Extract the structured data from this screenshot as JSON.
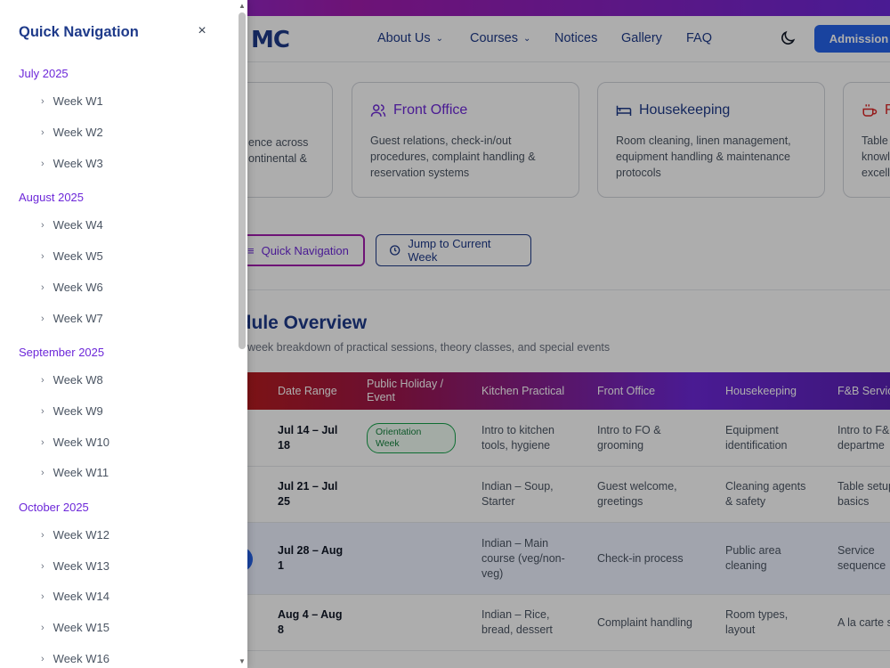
{
  "header": {
    "logo_main": "MC",
    "nav": [
      {
        "label": "About Us",
        "has_dropdown": true
      },
      {
        "label": "Courses",
        "has_dropdown": true
      },
      {
        "label": "Notices",
        "has_dropdown": false
      },
      {
        "label": "Gallery",
        "has_dropdown": false
      },
      {
        "label": "FAQ",
        "has_dropdown": false
      }
    ],
    "theme_toggle_icon": "moon-icon",
    "admission_label": "Admission"
  },
  "cards": [
    {
      "title": "",
      "desc_line1": "ence across",
      "desc_line2": "ontinental &",
      "desc_line3": ""
    },
    {
      "icon": "users-icon",
      "title": "Front Office",
      "desc_line1": "Guest relations, check-in/out",
      "desc_line2": "procedures, complaint handling &",
      "desc_line3": "reservation systems"
    },
    {
      "icon": "bed-icon",
      "title": "Housekeeping",
      "desc_line1": "Room cleaning, linen management,",
      "desc_line2": "equipment handling & maintenance",
      "desc_line3": "protocols"
    },
    {
      "icon": "coffee-icon",
      "title": "F",
      "desc_line1": "Table",
      "desc_line2": "knowl",
      "desc_line3": "excell"
    }
  ],
  "buttons": {
    "quick_nav": "Quick Navigation",
    "jump_week": "Jump to Current Week"
  },
  "schedule": {
    "title": "edule Overview",
    "subtitle": "week breakdown of practical sessions, theory classes, and special events",
    "columns": [
      "Date Range",
      "Public Holiday / Event",
      "Kitchen Practical",
      "Front Office",
      "Housekeeping",
      "F&B Servic"
    ],
    "rows": [
      {
        "date": "Jul 14 – Jul 18",
        "event": "Orientation Week",
        "kitchen": "Intro to kitchen tools, hygiene",
        "front": "Intro to FO & grooming",
        "house": "Equipment identification",
        "fb": "Intro to F& departme"
      },
      {
        "date": "Jul 21 – Jul 25",
        "event": "",
        "kitchen": "Indian – Soup, Starter",
        "front": "Guest welcome, greetings",
        "house": "Cleaning agents & safety",
        "fb": "Table setup basics"
      },
      {
        "date": "Jul 28 – Aug 1",
        "event": "",
        "kitchen": "Indian – Main course (veg/non-veg)",
        "front": "Check-in process",
        "house": "Public area cleaning",
        "fb": "Service sequence"
      },
      {
        "date": "Aug 4 – Aug 8",
        "event": "",
        "kitchen": "Indian – Rice, bread, dessert",
        "front": "Complaint handling",
        "house": "Room types, layout",
        "fb": "A la carte s"
      }
    ]
  },
  "drawer": {
    "title": "Quick Navigation",
    "close_icon": "×",
    "months": [
      {
        "label": "July 2025",
        "weeks": [
          "Week W1",
          "Week W2",
          "Week W3"
        ]
      },
      {
        "label": "August 2025",
        "weeks": [
          "Week W4",
          "Week W5",
          "Week W6",
          "Week W7"
        ]
      },
      {
        "label": "September 2025",
        "weeks": [
          "Week W8",
          "Week W9",
          "Week W10",
          "Week W11"
        ]
      },
      {
        "label": "October 2025",
        "weeks": [
          "Week W12",
          "Week W13",
          "Week W14",
          "Week W15",
          "Week W16"
        ]
      }
    ]
  }
}
